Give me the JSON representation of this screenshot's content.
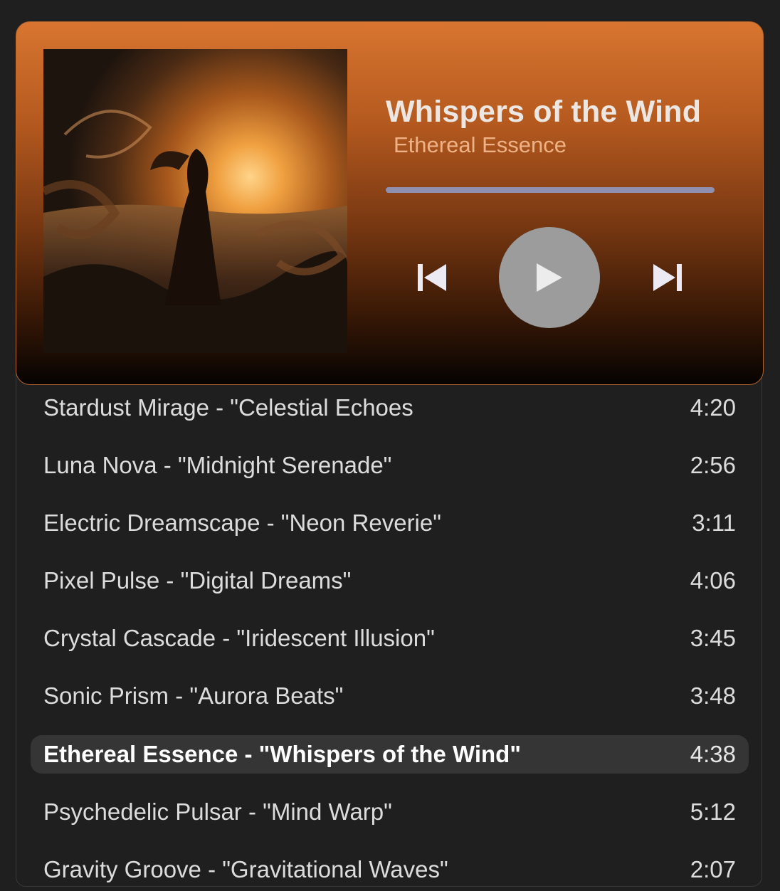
{
  "now_playing": {
    "title": "Whispers of the Wind",
    "artist": "Ethereal Essence",
    "album_art": "woman-in-wind-sunset-art",
    "progress": 0.0
  },
  "controls": {
    "previous_icon": "skip-previous-icon",
    "play_icon": "play-icon",
    "next_icon": "skip-next-icon"
  },
  "colors": {
    "header_top": "#d87530",
    "header_bottom": "#060302",
    "progress_track": "#8f8fb0",
    "play_button": "#9c9c9c",
    "active_row": "#353535",
    "background": "#1f1f1f"
  },
  "playlist": [
    {
      "name": "Stardust Mirage - \"Celestial Echoes",
      "duration": "4:20"
    },
    {
      "name": "Luna Nova - \"Midnight Serenade\"",
      "duration": "2:56"
    },
    {
      "name": "Electric Dreamscape - \"Neon Reverie\"",
      "duration": "3:11"
    },
    {
      "name": "Pixel Pulse - \"Digital Dreams\"",
      "duration": "4:06"
    },
    {
      "name": "Crystal Cascade - \"Iridescent Illusion\"",
      "duration": "3:45"
    },
    {
      "name": "Sonic Prism - \"Aurora Beats\"",
      "duration": "3:48"
    },
    {
      "name": "Ethereal Essence - \"Whispers of the Wind\"",
      "duration": "4:38",
      "active": true
    },
    {
      "name": "Psychedelic Pulsar - \"Mind Warp\"",
      "duration": "5:12"
    },
    {
      "name": "Gravity Groove - \"Gravitational Waves\"",
      "duration": "2:07"
    }
  ]
}
